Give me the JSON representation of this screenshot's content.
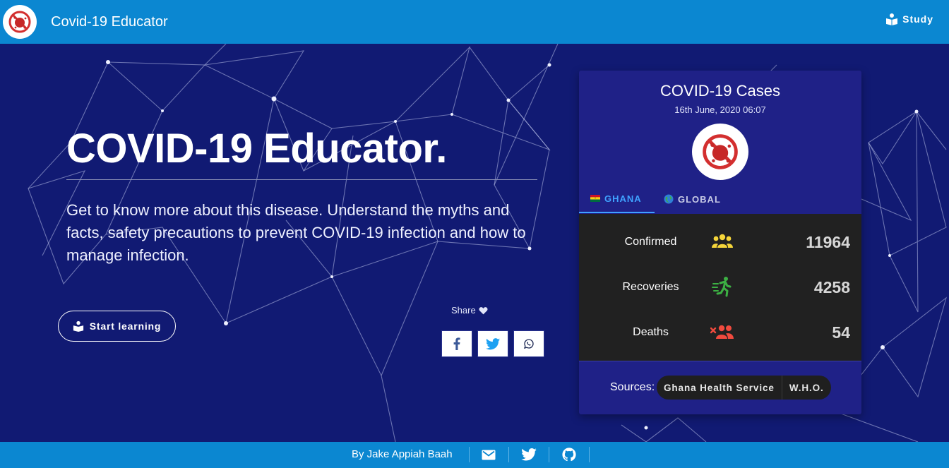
{
  "app": {
    "title": "Covid-19 Educator",
    "study_label": "Study"
  },
  "hero": {
    "title": "COVID-19 Educator.",
    "description": "Get to know more about this disease. Understand the myths and facts, safety precautions to prevent COVID-19 infection and how to manage infection.",
    "start_label": "Start learning",
    "share_label": "Share"
  },
  "share": [
    {
      "name": "facebook-icon",
      "color": "#3b5998"
    },
    {
      "name": "twitter-icon",
      "color": "#1da1f2"
    },
    {
      "name": "whatsapp-icon",
      "color": "#1f2a55"
    }
  ],
  "card": {
    "title": "COVID-19 Cases",
    "date": "16th June, 2020 06:07",
    "tabs": [
      {
        "label": "GHANA",
        "active": true
      },
      {
        "label": "GLOBAL",
        "active": false
      }
    ],
    "stats": [
      {
        "label": "Confirmed",
        "value": "11964",
        "icon": "people-icon",
        "color": "#f5d53a"
      },
      {
        "label": "Recoveries",
        "value": "4258",
        "icon": "running-person-icon",
        "color": "#3cb043"
      },
      {
        "label": "Deaths",
        "value": "54",
        "icon": "people-remove-icon",
        "color": "#f04a3e"
      }
    ],
    "sources_label": "Sources:",
    "sources": [
      "Ghana Health Service",
      "W.H.O."
    ]
  },
  "footer": {
    "author": "By Jake Appiah Baah"
  },
  "colors": {
    "topbar": "#0b87d1",
    "background": "#111a73",
    "card": "#1f2187",
    "stats_panel": "#212121",
    "accent": "#3fa2ff"
  }
}
